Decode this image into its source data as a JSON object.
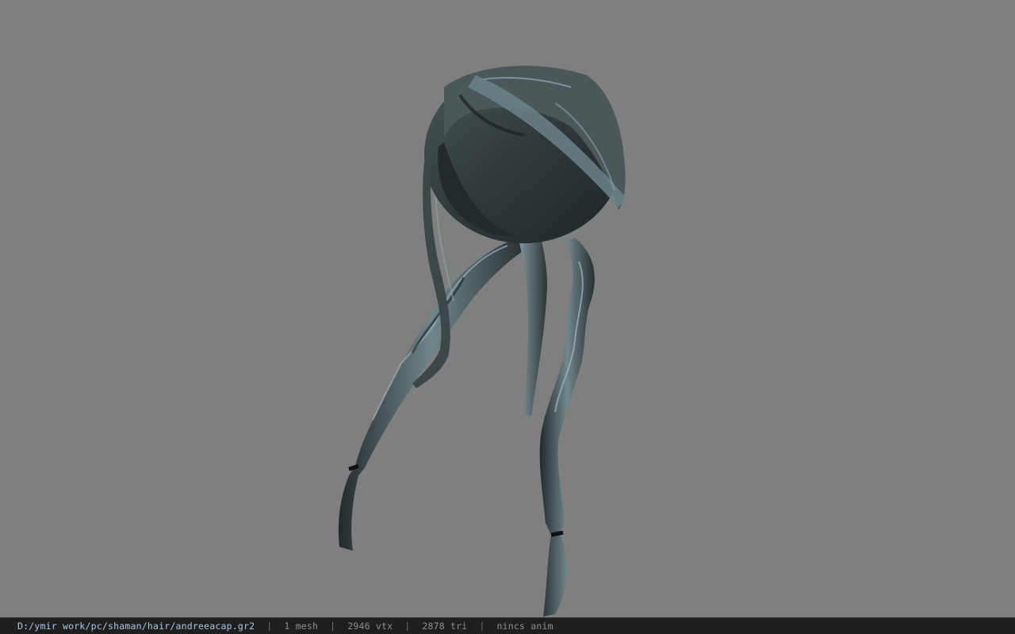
{
  "viewer": {
    "background_color": "#7f7f7f",
    "model_color": "#3a4446",
    "highlight_color": "#8aa0a6"
  },
  "status_bar": {
    "file_path": "D:/ymir work/pc/shaman/hair/andreeacap.gr2",
    "separator": "|",
    "mesh_count": "1 mesh",
    "vertex_count": "2946 vtx",
    "triangle_count": "2878 tri",
    "animation": "nincs anim"
  }
}
